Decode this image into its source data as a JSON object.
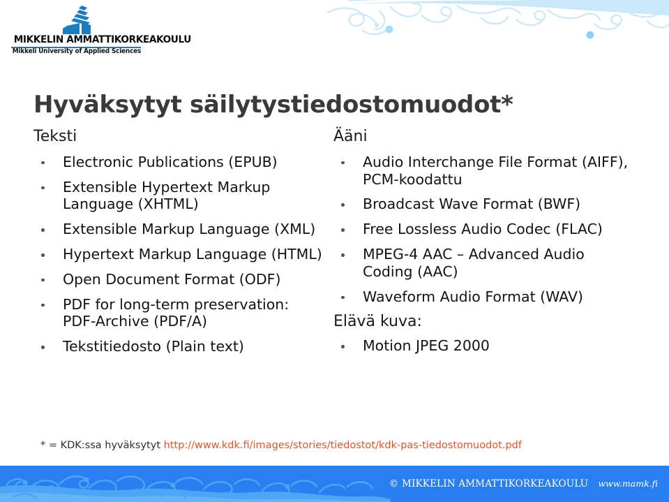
{
  "slide": {
    "title": "Hyväksytyt säilytystiedostomuodot*"
  },
  "logo": {
    "mark_name": "mamk-flag-wave-logo-icon",
    "wordmark": "MIKKELIN AMMATTIKORKEAKOULU",
    "subtitle": "Mikkeli University of Applied Sciences"
  },
  "left_column": {
    "heading": "Teksti",
    "items": [
      "Electronic Publications (EPUB)",
      "Extensible Hypertext Markup Language (XHTML)",
      "Extensible Markup Language (XML)",
      "Hypertext Markup Language (HTML)",
      "Open Document Format (ODF)",
      "PDF for long-term preservation: PDF-Archive (PDF/A)",
      "Tekstitiedosto (Plain text)"
    ]
  },
  "right_column": {
    "heading": "Ääni",
    "items": [
      "Audio Interchange File Format (AIFF), PCM-koodattu",
      "Broadcast Wave Format (BWF)",
      "Free Lossless Audio Codec (FLAC)",
      "MPEG-4 AAC – Advanced Audio Coding (AAC)",
      "Waveform Audio Format (WAV)"
    ],
    "subheading": "Elävä kuva:",
    "sub_items": [
      "Motion JPEG 2000"
    ]
  },
  "footnote": {
    "prefix": "* = KDK:ssa hyväksytyt ",
    "url": "http://www.kdk.fi/images/stories/tiedostot/kdk-pas-tiedostomuodot.pdf"
  },
  "footer": {
    "copyright": "© MIKKELIN AMMATTIKORKEAKOULU",
    "website": "www.mamk.fi"
  },
  "colors": {
    "title_text": "#3a3a3a",
    "body_text": "#131313",
    "logo_blue": "#1b7cc0",
    "top_deco_blue": "#c9e9fa",
    "footer_blue": "#2a7ff0",
    "footer_wave_blue": "#4da6f5",
    "link_orange": "#e2552a"
  }
}
